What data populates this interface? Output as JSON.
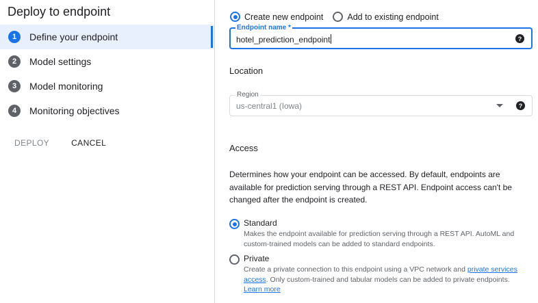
{
  "left": {
    "title": "Deploy to endpoint",
    "steps": [
      {
        "num": "1",
        "label": "Define your endpoint"
      },
      {
        "num": "2",
        "label": "Model settings"
      },
      {
        "num": "3",
        "label": "Model monitoring"
      },
      {
        "num": "4",
        "label": "Monitoring objectives"
      }
    ],
    "deploy_label": "DEPLOY",
    "cancel_label": "CANCEL"
  },
  "endpoint_choice": {
    "create_label": "Create new endpoint",
    "existing_label": "Add to existing endpoint"
  },
  "endpoint_name": {
    "label": "Endpoint name *",
    "value": "hotel_prediction_endpoint"
  },
  "location": {
    "title": "Location",
    "region_label": "Region",
    "region_value": "us-central1 (Iowa)"
  },
  "access": {
    "title": "Access",
    "description": "Determines how your endpoint can be accessed. By default, endpoints are available for prediction serving through a REST API. Endpoint access can't be changed after the endpoint is created.",
    "standard_title": "Standard",
    "standard_desc": "Makes the endpoint available for prediction serving through a REST API. AutoML and custom-trained models can be added to standard endpoints.",
    "private_title": "Private",
    "private_desc_1": "Create a private connection to this endpoint using a VPC network and ",
    "private_link": "private services access",
    "private_desc_2": ". Only custom-trained and tabular models can be added to private endpoints.",
    "learn_more": "Learn more"
  },
  "icons": {
    "help": "?"
  },
  "colors": {
    "accent": "#1a73e8",
    "active_bg": "#e8f0fe"
  }
}
